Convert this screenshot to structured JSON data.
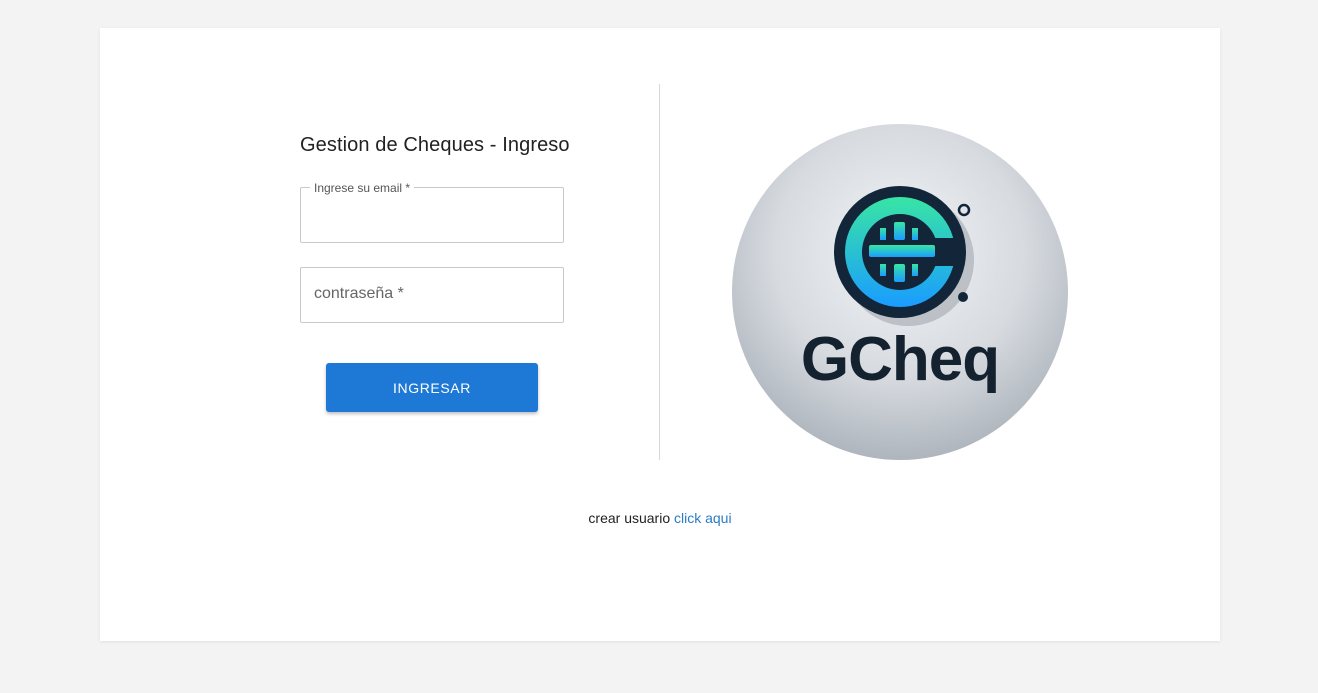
{
  "login": {
    "title": "Gestion de Cheques - Ingreso",
    "email_label": "Ingrese su email *",
    "email_value": "",
    "password_placeholder": "contraseña *",
    "password_value": "",
    "submit_label": "INGRESAR"
  },
  "logo": {
    "text": "GCheq",
    "colors": {
      "dark": "#0f1e2e",
      "accent_green": "#33e0a0",
      "accent_blue": "#1f9bff",
      "background": "#c9ced4"
    }
  },
  "footer": {
    "text": "crear usuario",
    "link_label": "click aqui"
  },
  "colors": {
    "button": "#1e78d6",
    "link": "#2a7bc6",
    "page_background": "#f3f3f3"
  }
}
